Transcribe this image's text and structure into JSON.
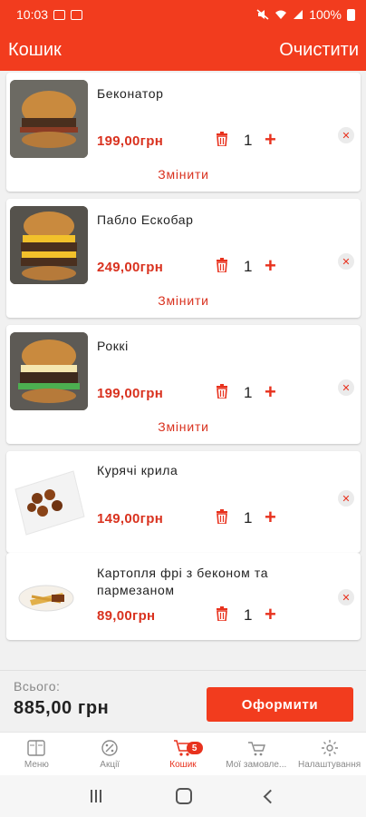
{
  "status_bar": {
    "time": "10:03",
    "battery": "100%"
  },
  "app_bar": {
    "title": "Кошик",
    "clear_label": "Очистити"
  },
  "cart": {
    "items": [
      {
        "name": "Беконатор",
        "price": "199,00грн",
        "quantity": "1",
        "change_label": "Змінити"
      },
      {
        "name": "Пабло Ескобар",
        "price": "249,00грн",
        "quantity": "1",
        "change_label": "Змінити"
      },
      {
        "name": "Роккі",
        "price": "199,00грн",
        "quantity": "1",
        "change_label": "Змінити"
      },
      {
        "name": "Курячі крила",
        "price": "149,00грн",
        "quantity": "1"
      },
      {
        "name": "Картопля фрі з беконом та пармезаном",
        "price": "89,00грн",
        "quantity": "1"
      }
    ],
    "plus_symbol": "+",
    "remove_symbol": "✕"
  },
  "summary": {
    "total_label": "Всього:",
    "total_value": "885,00 грн",
    "checkout_label": "Оформити"
  },
  "tabs": [
    {
      "label": "Меню",
      "icon": "menu-book-icon"
    },
    {
      "label": "Акції",
      "icon": "percent-icon"
    },
    {
      "label": "Кошик",
      "icon": "cart-icon",
      "badge": "5",
      "active": true
    },
    {
      "label": "Мої замовле...",
      "icon": "orders-icon"
    },
    {
      "label": "Налаштування",
      "icon": "gear-icon"
    }
  ],
  "colors": {
    "accent": "#f23c1e",
    "price": "#d9321f",
    "background": "#f1f1f1"
  }
}
